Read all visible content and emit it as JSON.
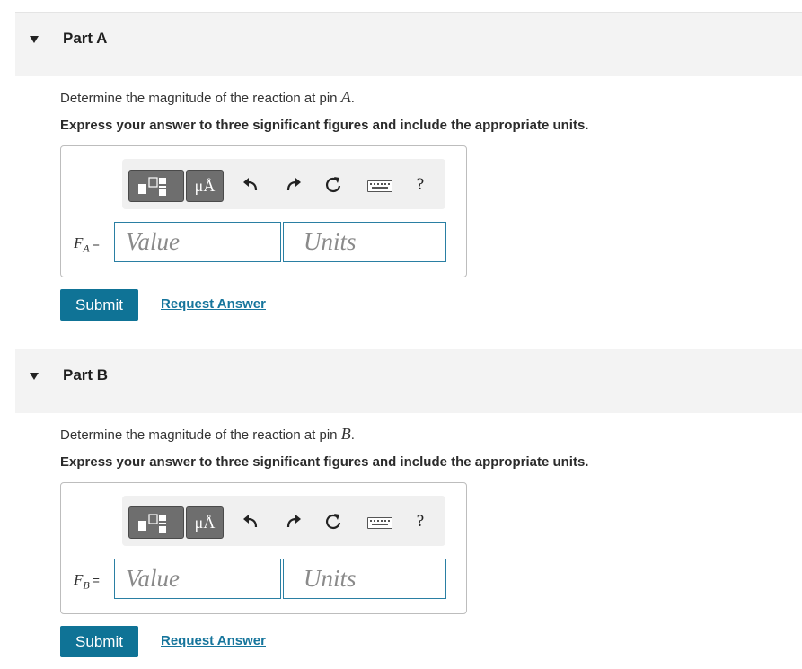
{
  "parts": [
    {
      "title": "Part A",
      "question_prefix": "Determine the magnitude of the reaction at pin ",
      "question_var": "A",
      "question_suffix": ".",
      "instruction": "Express your answer to three significant figures and include the appropriate units.",
      "label_symbol": "F",
      "label_sub": "A",
      "label_eq": "=",
      "value_placeholder": "Value",
      "units_placeholder": "Units",
      "submit_label": "Submit",
      "request_label": "Request Answer"
    },
    {
      "title": "Part B",
      "question_prefix": "Determine the magnitude of the reaction at pin ",
      "question_var": "B",
      "question_suffix": ".",
      "instruction": "Express your answer to three significant figures and include the appropriate units.",
      "label_symbol": "F",
      "label_sub": "B",
      "label_eq": "=",
      "value_placeholder": "Value",
      "units_placeholder": "Units",
      "submit_label": "Submit",
      "request_label": "Request Answer"
    }
  ],
  "toolbar": {
    "units_button": "μÅ",
    "undo_icon": "↶",
    "redo_icon": "↷",
    "reset_icon": "↻",
    "help_label": "?"
  },
  "colors": {
    "accent": "#0f7396",
    "link": "#16759c",
    "input_border": "#2a7fa3",
    "header_bg": "#f3f3f3"
  }
}
